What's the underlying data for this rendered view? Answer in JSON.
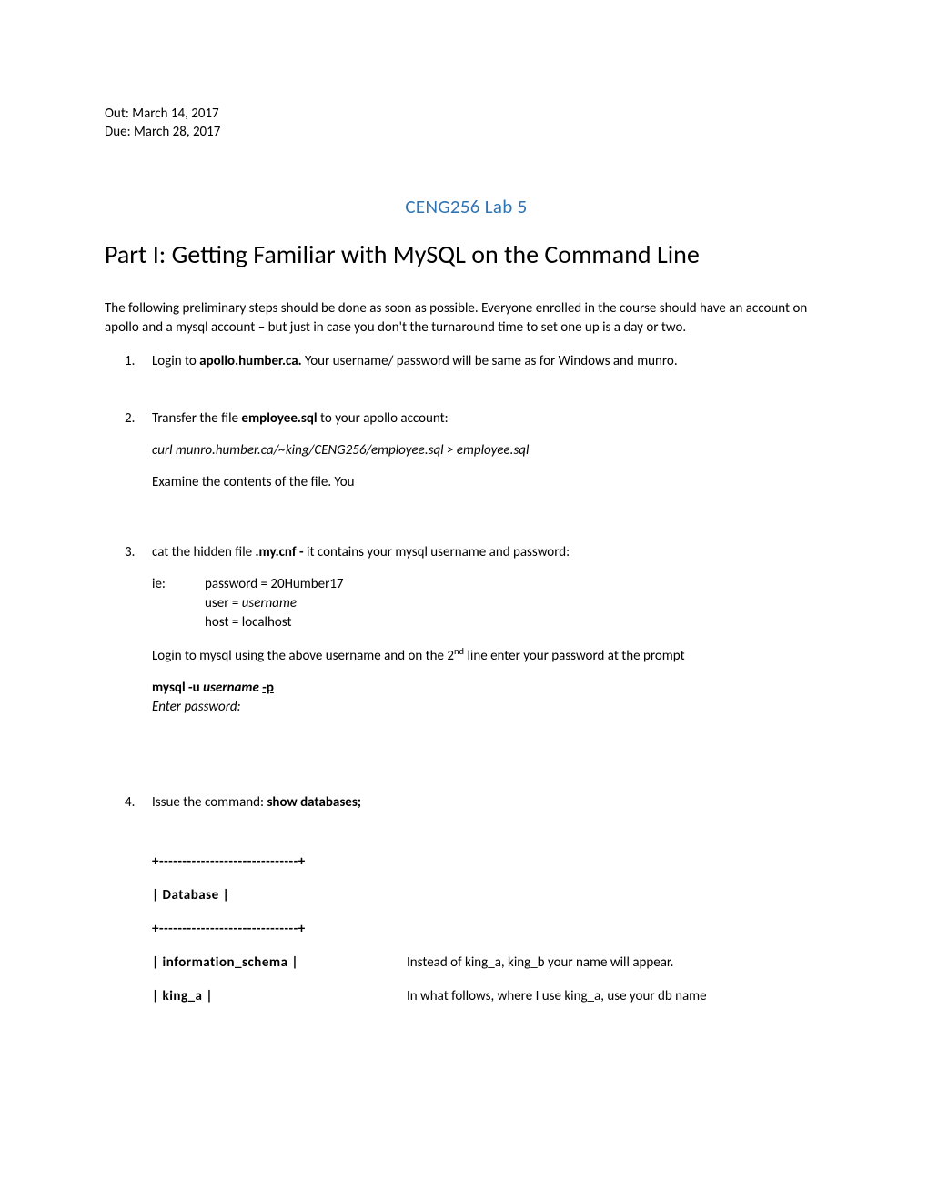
{
  "meta": {
    "out": "Out: March 14, 2017",
    "due": "Due: March 28, 2017"
  },
  "title": "CENG256 Lab 5",
  "part_title": "Part I:  Getting Familiar with MySQL on the Command Line",
  "intro": "The following preliminary steps should be done as soon as possible.   Everyone enrolled in the course should have an account on apollo and a mysql account – but just in case you don't the turnaround time to set one up is a day or two.",
  "steps": {
    "s1": {
      "num": "1.",
      "t1": "Login to ",
      "t2": "apollo.humber.ca.",
      "t3": "    Your username/ password will be same as for Windows and munro."
    },
    "s2": {
      "num": "2.",
      "t1": "Transfer the file ",
      "t2": "employee.sql",
      "t3": "  to your apollo account:",
      "cmd": "curl    munro.humber.ca/~king/CENG256/employee.sql > employee.sql",
      "t4": "Examine the contents of the file.  You"
    },
    "s3": {
      "num": "3.",
      "t1": "cat the hidden file ",
      "t2": ".my.cnf   -",
      "t3": "  it contains your mysql username and password:",
      "ie_label": "ie:",
      "ie1a": "password = 20Humber17",
      "ie2a": "user = ",
      "ie2b": "username",
      "ie3": "host = localhost",
      "login1": "Login to mysql using the above username and on the 2",
      "login_sup": "nd",
      "login2": " line enter your password at the prompt",
      "cmd1a": "mysql  -u ",
      "cmd1b": "username",
      "cmd1c": "  ",
      "cmd1d": "-p",
      "cmd2": "Enter  password:"
    },
    "s4": {
      "num": "4.",
      "t1": "Issue the command:   ",
      "t2": "show databases;",
      "rows": {
        "r1": "+------------------------------+",
        "r2": "| Database                       |",
        "r3": "+------------------------------+",
        "r4l": "| information_schema  |",
        "r4r": "Instead of king_a, king_b your name will appear.",
        "r5l": "| king_a                           |",
        "r5r": "In what follows, where I use king_a, use your db name"
      }
    }
  }
}
